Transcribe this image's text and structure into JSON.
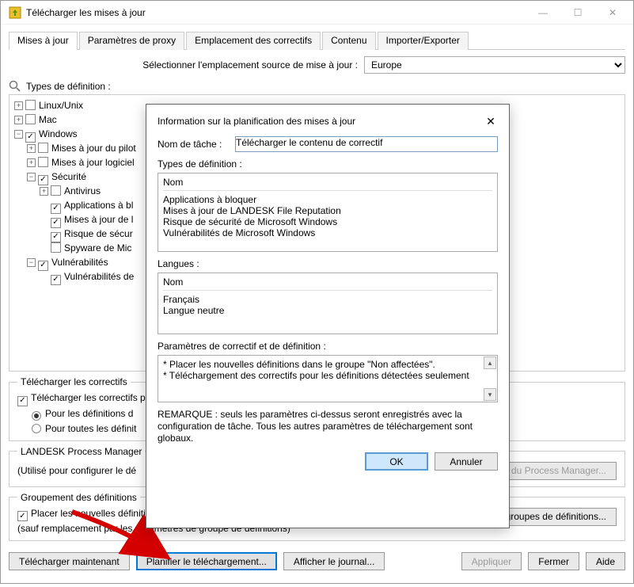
{
  "window": {
    "title": "Télécharger les mises à jour"
  },
  "tabs": [
    "Mises à jour",
    "Paramètres de proxy",
    "Emplacement des correctifs",
    "Contenu",
    "Importer/Exporter"
  ],
  "source": {
    "label": "Sélectionner l'emplacement source de mise à jour :",
    "value": "Europe"
  },
  "tree_header": "Types de définition :",
  "tree": {
    "linux": "Linux/Unix",
    "mac": "Mac",
    "windows": "Windows",
    "win_maj_pilot": "Mises à jour du pilot",
    "win_maj_log": "Mises à jour logiciel",
    "securite": "Sécurité",
    "antivirus": "Antivirus",
    "apps_block": "Applications à bl",
    "maj_de": "Mises à jour de l",
    "risque": "Risque de sécur",
    "spyware": "Spyware de Mic",
    "vuln": "Vulnérabilités",
    "vuln_de": "Vulnérabilités de"
  },
  "groupbox1": {
    "legend": "Télécharger les correctifs",
    "cb": "Télécharger les correctifs p",
    "r1": "Pour les définitions d",
    "r2": "Pour toutes les définit"
  },
  "groupbox2": {
    "legend": "LANDESK Process Manager",
    "text": "(Utilisé pour configurer le dé",
    "btn": "tion du Process Manager..."
  },
  "groupbox3": {
    "legend": "Groupement des définitions",
    "cb": "Placer les nouvelles définitions dans le groupe \"Non affecté\"",
    "note": "(sauf remplacement par les paramètres de groupe de définitions)",
    "btn": "Paramètres des groupes de définitions..."
  },
  "bottom": {
    "b1": "Télécharger maintenant",
    "b2": "Planifier le téléchargement...",
    "b3": "Afficher le journal...",
    "apply": "Appliquer",
    "close": "Fermer",
    "help": "Aide"
  },
  "modal": {
    "title": "Information sur la planification des mises à jour",
    "task_label": "Nom de tâche :",
    "task_value": "Télécharger le contenu de correctif",
    "types_label": "Types de définition :",
    "types_header": "Nom",
    "types_items": [
      "Applications à bloquer",
      "Mises à jour de LANDESK File Reputation",
      "Risque de sécurité de Microsoft Windows",
      "Vulnérabilités de Microsoft Windows"
    ],
    "langs_label": "Langues :",
    "langs_header": "Nom",
    "langs_items": [
      "Français",
      "Langue neutre"
    ],
    "params_label": "Paramètres de correctif et de définition :",
    "params_items": [
      "* Placer les nouvelles définitions dans le groupe \"Non affectées\".",
      "* Téléchargement des correctifs pour les définitions détectées seulement"
    ],
    "note": "REMARQUE : seuls les paramètres ci-dessus seront enregistrés avec la configuration de tâche. Tous les autres paramètres de téléchargement sont globaux.",
    "ok": "OK",
    "cancel": "Annuler"
  }
}
